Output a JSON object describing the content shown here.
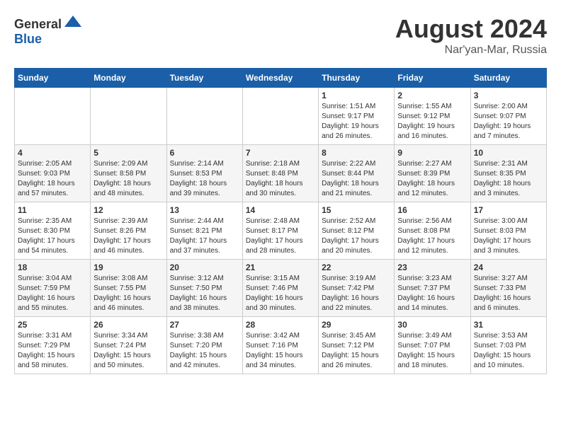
{
  "header": {
    "logo_general": "General",
    "logo_blue": "Blue",
    "title": "August 2024",
    "subtitle": "Nar'yan-Mar, Russia"
  },
  "days_of_week": [
    "Sunday",
    "Monday",
    "Tuesday",
    "Wednesday",
    "Thursday",
    "Friday",
    "Saturday"
  ],
  "weeks": [
    [
      {
        "day": "",
        "info": ""
      },
      {
        "day": "",
        "info": ""
      },
      {
        "day": "",
        "info": ""
      },
      {
        "day": "",
        "info": ""
      },
      {
        "day": "1",
        "info": "Sunrise: 1:51 AM\nSunset: 9:17 PM\nDaylight: 19 hours\nand 26 minutes."
      },
      {
        "day": "2",
        "info": "Sunrise: 1:55 AM\nSunset: 9:12 PM\nDaylight: 19 hours\nand 16 minutes."
      },
      {
        "day": "3",
        "info": "Sunrise: 2:00 AM\nSunset: 9:07 PM\nDaylight: 19 hours\nand 7 minutes."
      }
    ],
    [
      {
        "day": "4",
        "info": "Sunrise: 2:05 AM\nSunset: 9:03 PM\nDaylight: 18 hours\nand 57 minutes."
      },
      {
        "day": "5",
        "info": "Sunrise: 2:09 AM\nSunset: 8:58 PM\nDaylight: 18 hours\nand 48 minutes."
      },
      {
        "day": "6",
        "info": "Sunrise: 2:14 AM\nSunset: 8:53 PM\nDaylight: 18 hours\nand 39 minutes."
      },
      {
        "day": "7",
        "info": "Sunrise: 2:18 AM\nSunset: 8:48 PM\nDaylight: 18 hours\nand 30 minutes."
      },
      {
        "day": "8",
        "info": "Sunrise: 2:22 AM\nSunset: 8:44 PM\nDaylight: 18 hours\nand 21 minutes."
      },
      {
        "day": "9",
        "info": "Sunrise: 2:27 AM\nSunset: 8:39 PM\nDaylight: 18 hours\nand 12 minutes."
      },
      {
        "day": "10",
        "info": "Sunrise: 2:31 AM\nSunset: 8:35 PM\nDaylight: 18 hours\nand 3 minutes."
      }
    ],
    [
      {
        "day": "11",
        "info": "Sunrise: 2:35 AM\nSunset: 8:30 PM\nDaylight: 17 hours\nand 54 minutes."
      },
      {
        "day": "12",
        "info": "Sunrise: 2:39 AM\nSunset: 8:26 PM\nDaylight: 17 hours\nand 46 minutes."
      },
      {
        "day": "13",
        "info": "Sunrise: 2:44 AM\nSunset: 8:21 PM\nDaylight: 17 hours\nand 37 minutes."
      },
      {
        "day": "14",
        "info": "Sunrise: 2:48 AM\nSunset: 8:17 PM\nDaylight: 17 hours\nand 28 minutes."
      },
      {
        "day": "15",
        "info": "Sunrise: 2:52 AM\nSunset: 8:12 PM\nDaylight: 17 hours\nand 20 minutes."
      },
      {
        "day": "16",
        "info": "Sunrise: 2:56 AM\nSunset: 8:08 PM\nDaylight: 17 hours\nand 12 minutes."
      },
      {
        "day": "17",
        "info": "Sunrise: 3:00 AM\nSunset: 8:03 PM\nDaylight: 17 hours\nand 3 minutes."
      }
    ],
    [
      {
        "day": "18",
        "info": "Sunrise: 3:04 AM\nSunset: 7:59 PM\nDaylight: 16 hours\nand 55 minutes."
      },
      {
        "day": "19",
        "info": "Sunrise: 3:08 AM\nSunset: 7:55 PM\nDaylight: 16 hours\nand 46 minutes."
      },
      {
        "day": "20",
        "info": "Sunrise: 3:12 AM\nSunset: 7:50 PM\nDaylight: 16 hours\nand 38 minutes."
      },
      {
        "day": "21",
        "info": "Sunrise: 3:15 AM\nSunset: 7:46 PM\nDaylight: 16 hours\nand 30 minutes."
      },
      {
        "day": "22",
        "info": "Sunrise: 3:19 AM\nSunset: 7:42 PM\nDaylight: 16 hours\nand 22 minutes."
      },
      {
        "day": "23",
        "info": "Sunrise: 3:23 AM\nSunset: 7:37 PM\nDaylight: 16 hours\nand 14 minutes."
      },
      {
        "day": "24",
        "info": "Sunrise: 3:27 AM\nSunset: 7:33 PM\nDaylight: 16 hours\nand 6 minutes."
      }
    ],
    [
      {
        "day": "25",
        "info": "Sunrise: 3:31 AM\nSunset: 7:29 PM\nDaylight: 15 hours\nand 58 minutes."
      },
      {
        "day": "26",
        "info": "Sunrise: 3:34 AM\nSunset: 7:24 PM\nDaylight: 15 hours\nand 50 minutes."
      },
      {
        "day": "27",
        "info": "Sunrise: 3:38 AM\nSunset: 7:20 PM\nDaylight: 15 hours\nand 42 minutes."
      },
      {
        "day": "28",
        "info": "Sunrise: 3:42 AM\nSunset: 7:16 PM\nDaylight: 15 hours\nand 34 minutes."
      },
      {
        "day": "29",
        "info": "Sunrise: 3:45 AM\nSunset: 7:12 PM\nDaylight: 15 hours\nand 26 minutes."
      },
      {
        "day": "30",
        "info": "Sunrise: 3:49 AM\nSunset: 7:07 PM\nDaylight: 15 hours\nand 18 minutes."
      },
      {
        "day": "31",
        "info": "Sunrise: 3:53 AM\nSunset: 7:03 PM\nDaylight: 15 hours\nand 10 minutes."
      }
    ]
  ]
}
